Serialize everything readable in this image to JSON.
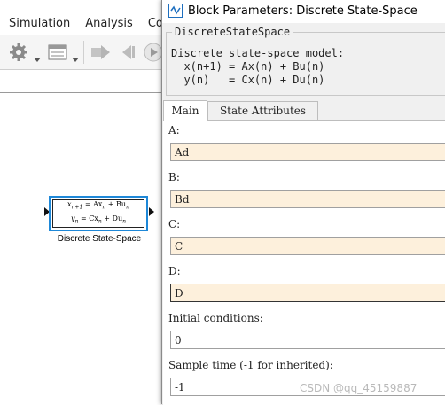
{
  "main_window": {
    "menu": [
      "Simulation",
      "Analysis",
      "Code"
    ],
    "toolbar_icons": [
      "gear-icon",
      "library-icon",
      "step-back-icon",
      "run-icon"
    ],
    "block": {
      "eq1": "x_{n+1} = Ax_n + Bu_n",
      "eq1_parts": {
        "lhs": "x",
        "lhs_sub": "n+1",
        "rhs_a": " = Ax",
        "rhs_a_sub": "n",
        "rhs_b": " + Bu",
        "rhs_b_sub": "n"
      },
      "eq2_parts": {
        "lhs": "y",
        "lhs_sub": "n",
        "rhs_a": " = Cx",
        "rhs_a_sub": "n",
        "rhs_b": " + Du",
        "rhs_b_sub": "n"
      },
      "caption": "Discrete State-Space"
    }
  },
  "dialog": {
    "title": "Block Parameters: Discrete State-Space",
    "group_title": "DiscreteStateSpace",
    "description": [
      "Discrete state-space model:",
      "  x(n+1) = Ax(n) + Bu(n)",
      "  y(n)   = Cx(n) + Du(n)"
    ],
    "tabs": [
      {
        "label": "Main",
        "active": true
      },
      {
        "label": "State Attributes",
        "active": false
      }
    ],
    "params": [
      {
        "label": "A:",
        "value": "Ad"
      },
      {
        "label": "B:",
        "value": "Bd"
      },
      {
        "label": "C:",
        "value": "C"
      },
      {
        "label": "D:",
        "value": "D"
      },
      {
        "label": "Initial conditions:",
        "value": "0"
      },
      {
        "label": "Sample time (-1 for inherited):",
        "value": "-1"
      }
    ]
  },
  "watermark": "CSDN @qq_45159887",
  "colors": {
    "field_bg": "#fdf0dc",
    "block_border": "#1e88d8"
  }
}
